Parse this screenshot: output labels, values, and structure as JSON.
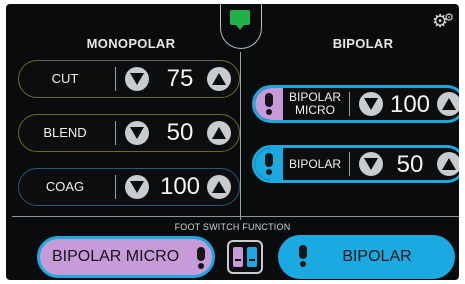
{
  "monopolar": {
    "title": "MONOPOLAR",
    "cut": {
      "label": "CUT",
      "value": "75"
    },
    "blend": {
      "label": "BLEND",
      "value": "50"
    },
    "coag": {
      "label": "COAG",
      "value": "100"
    }
  },
  "bipolar": {
    "title": "BIPOLAR",
    "micro": {
      "label_line1": "BIPOLAR",
      "label_line2": "MICRO",
      "value": "100"
    },
    "standard": {
      "label": "BIPOLAR",
      "value": "50"
    }
  },
  "foot_switch": {
    "title": "FOOT SWITCH FUNCTION",
    "left_label": "BIPOLAR MICRO",
    "right_label": "BIPOLAR"
  },
  "colors": {
    "background": "#0a0b0c",
    "accent_blue": "#1aa9e0",
    "micro_purple": "#c79ad8",
    "indicator_green": "#1fb24a"
  },
  "icons": [
    "settings-gears-icon",
    "active-indicator-icon",
    "decrease-icon",
    "increase-icon",
    "foot-pedal-icon",
    "dual-pedal-icon"
  ]
}
